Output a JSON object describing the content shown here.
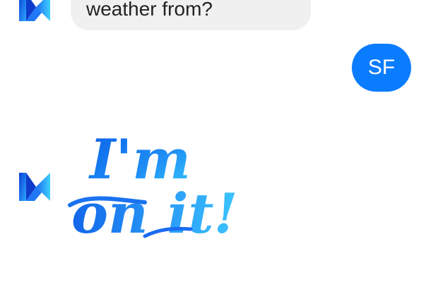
{
  "messages": {
    "incoming_partial": "weather from?",
    "outgoing": "SF",
    "sticker": {
      "line1": "I'm",
      "line2": "on it!"
    }
  },
  "icons": {
    "bot_avatar": "m-assistant-icon"
  },
  "colors": {
    "outgoing_bubble": "#0a7cff",
    "incoming_bubble": "#f0f0f0",
    "sticker_gradient_start": "#0a5ee8",
    "sticker_gradient_end": "#38c8ff"
  }
}
